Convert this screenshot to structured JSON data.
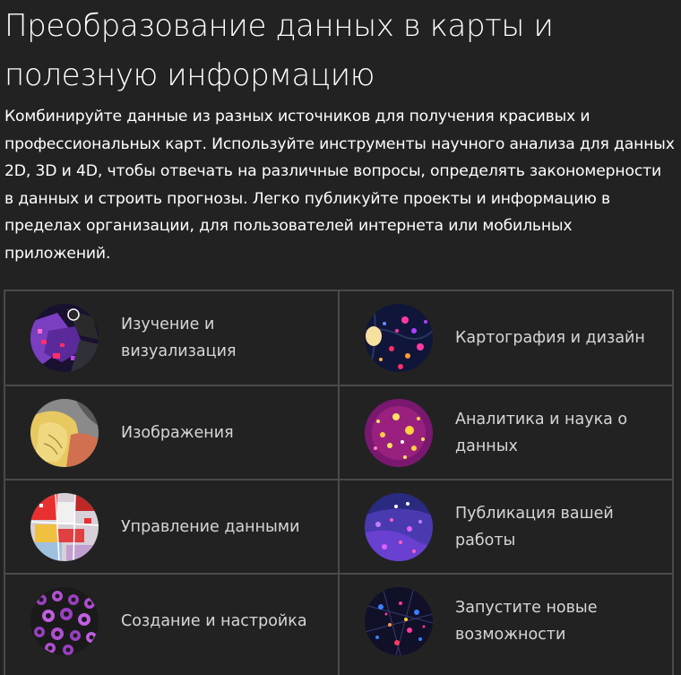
{
  "heading": {
    "title": "Преобразование данных в карты и полезную информацию",
    "description": "Комбинируйте данные из разных источников для получения красивых и профессиональных карт. Используйте инструменты научного анализа для данных 2D, 3D и 4D, чтобы отвечать на различные вопросы, определять закономерности в данных и строить прогнозы. Легко публикуйте проекты и информацию в пределах организации, для пользователей интернета или мобильных приложений."
  },
  "capabilities": [
    {
      "label": "Изучение и визуализация",
      "icon": "exploration-visualization-image"
    },
    {
      "label": "Картография и дизайн",
      "icon": "cartography-design-image"
    },
    {
      "label": "Изображения",
      "icon": "imagery-image"
    },
    {
      "label": "Аналитика и наука о данных",
      "icon": "analytics-data-science-image"
    },
    {
      "label": "Управление данными",
      "icon": "data-management-image"
    },
    {
      "label": "Публикация вашей работы",
      "icon": "publishing-image"
    },
    {
      "label": "Создание и настройка",
      "icon": "create-customize-image"
    },
    {
      "label": "Запустите новые возможности",
      "icon": "new-capabilities-image"
    }
  ],
  "colors": {
    "background": "#222222",
    "text": "#ffffff",
    "tile_text": "#d6d6d6",
    "border": "#4a4a4a"
  }
}
